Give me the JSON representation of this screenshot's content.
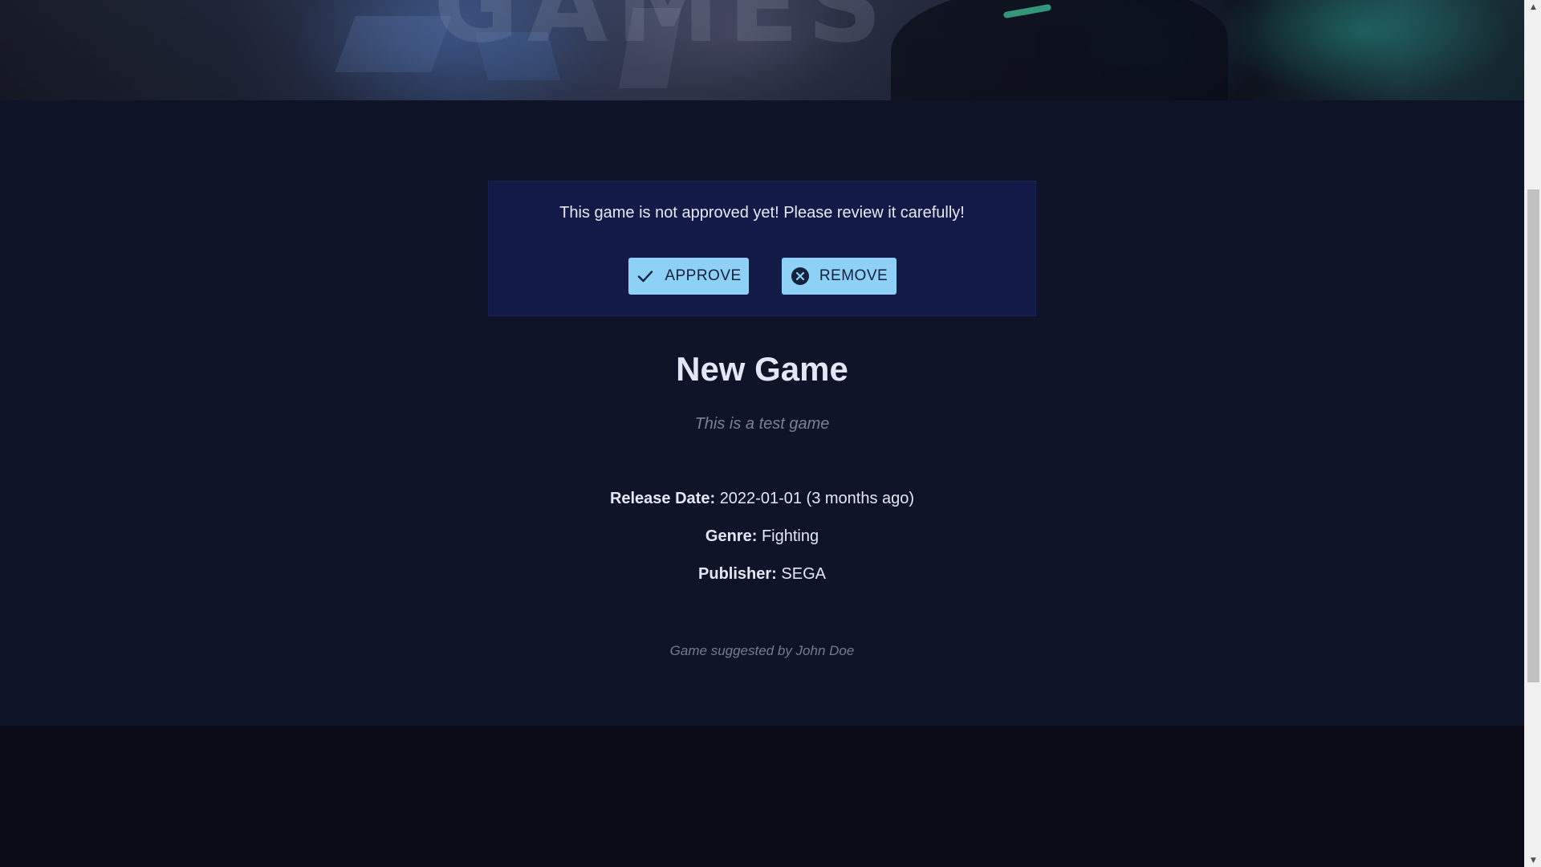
{
  "notice": {
    "text": "This game is not approved yet! Please review it carefully!",
    "approve_label": "APPROVE",
    "approve_icon": "check-icon",
    "remove_label": "REMOVE",
    "remove_icon": "close-circle-icon"
  },
  "game": {
    "title": "New Game",
    "description": "This is a test game",
    "release_label": "Release Date:",
    "release_value": "2022-01-01 (3 months ago)",
    "genre_label": "Genre:",
    "genre_value": "Fighting",
    "publisher_label": "Publisher:",
    "publisher_value": "SEGA",
    "suggested_by": "Game suggested by John Doe"
  },
  "colors": {
    "page_background": "#0f1328",
    "notice_background": "#131a48",
    "button_background": "#8fd0f7",
    "footer_background": "#0a0b16"
  }
}
